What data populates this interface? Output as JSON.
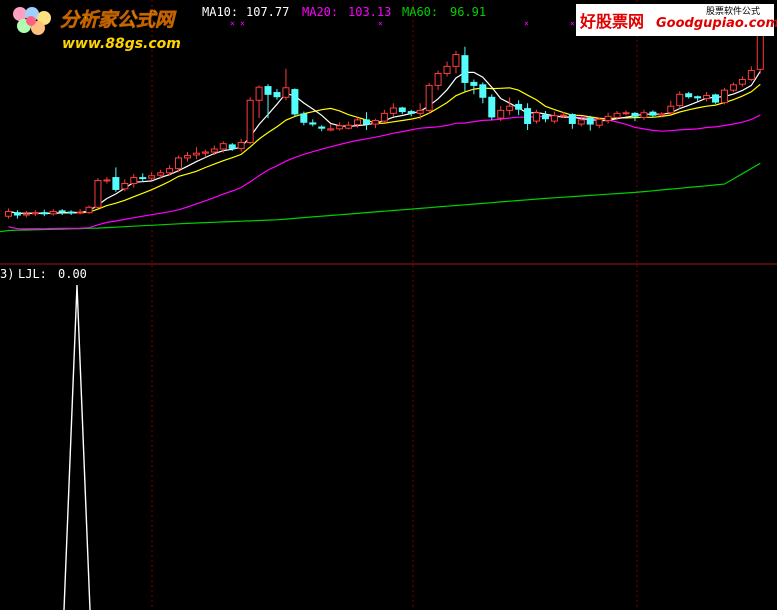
{
  "indicator_header": {
    "ma10_label": "MA10:",
    "ma10_value": "107.77",
    "ma20_label": "MA20:",
    "ma20_value": "103.13",
    "ma60_label": "MA60:",
    "ma60_value": "96.91"
  },
  "sub_header": {
    "prefix": "3)",
    "label": "LJL:",
    "value": "0.00"
  },
  "watermark_left": {
    "title": "分析家公式网",
    "url": "www.88gs.com"
  },
  "watermark_right": {
    "title": "好股票网",
    "domain": "Goodgupiao.com",
    "subtitle": "股票软件公式"
  },
  "colors": {
    "background": "#000000",
    "up": "#ff3c3c",
    "down": "#54fcfc",
    "ma5": "#ffffff",
    "ma10": "#ffff00",
    "ma20": "#ff00ff",
    "ma60": "#00d000",
    "separator": "#a01818",
    "grid": "#800000",
    "indicator": "#ffffff"
  },
  "chart_data": [
    {
      "type": "candlestick",
      "title": "",
      "series": [
        {
          "name": "MA10",
          "last": 107.77
        },
        {
          "name": "MA20",
          "last": 103.13
        },
        {
          "name": "MA60",
          "last": 96.91
        }
      ],
      "candles": [
        [
          88.0,
          88.8,
          87.6,
          89.3
        ],
        [
          88.6,
          88.2,
          87.6,
          89.0
        ],
        [
          88.2,
          88.4,
          87.8,
          88.9
        ],
        [
          88.4,
          88.6,
          88.0,
          89.0
        ],
        [
          88.6,
          88.4,
          88.0,
          89.1
        ],
        [
          88.4,
          88.8,
          88.1,
          89.2
        ],
        [
          88.9,
          88.7,
          88.2,
          89.2
        ],
        [
          88.7,
          88.6,
          88.2,
          89.0
        ],
        [
          88.6,
          88.7,
          88.3,
          89.2
        ],
        [
          88.6,
          89.5,
          88.4,
          89.8
        ],
        [
          89.5,
          94.0,
          89.3,
          94.4
        ],
        [
          94.0,
          94.1,
          93.5,
          94.6
        ],
        [
          94.5,
          92.5,
          92.1,
          96.2
        ],
        [
          92.6,
          93.5,
          92.2,
          94.2
        ],
        [
          93.5,
          94.5,
          92.8,
          95.1
        ],
        [
          94.5,
          94.4,
          93.9,
          95.2
        ],
        [
          94.4,
          94.8,
          94.0,
          95.4
        ],
        [
          94.9,
          95.3,
          94.3,
          95.8
        ],
        [
          95.3,
          96.0,
          94.8,
          96.6
        ],
        [
          96.0,
          97.8,
          95.4,
          98.2
        ],
        [
          97.8,
          98.2,
          97.2,
          98.8
        ],
        [
          98.3,
          98.6,
          97.6,
          99.6
        ],
        [
          98.6,
          98.8,
          97.9,
          99.2
        ],
        [
          98.8,
          99.3,
          98.3,
          99.9
        ],
        [
          99.3,
          100.2,
          98.7,
          100.6
        ],
        [
          100.0,
          99.4,
          99.0,
          100.3
        ],
        [
          99.4,
          100.4,
          98.9,
          101.0
        ],
        [
          100.4,
          107.5,
          100.1,
          108.0
        ],
        [
          107.5,
          109.7,
          104.5,
          110.0
        ],
        [
          109.8,
          108.5,
          104.5,
          110.2
        ],
        [
          108.8,
          108.1,
          107.6,
          109.4
        ],
        [
          108.0,
          109.6,
          107.5,
          112.8
        ],
        [
          109.3,
          105.2,
          104.7,
          109.5
        ],
        [
          105.2,
          103.8,
          103.3,
          105.6
        ],
        [
          103.7,
          103.5,
          103.1,
          104.3
        ],
        [
          103.0,
          102.8,
          102.3,
          103.3
        ],
        [
          102.5,
          102.7,
          102.3,
          103.5
        ],
        [
          102.7,
          103.2,
          102.4,
          103.8
        ],
        [
          102.8,
          103.3,
          102.6,
          103.9
        ],
        [
          103.4,
          104.2,
          102.9,
          104.6
        ],
        [
          104.2,
          103.5,
          102.5,
          105.5
        ],
        [
          103.5,
          104.1,
          102.8,
          104.4
        ],
        [
          104.0,
          105.3,
          103.7,
          105.9
        ],
        [
          105.3,
          106.2,
          104.8,
          107.0
        ],
        [
          106.2,
          105.6,
          105.2,
          106.4
        ],
        [
          105.6,
          105.3,
          104.8,
          105.9
        ],
        [
          105.3,
          105.8,
          104.3,
          107.0
        ],
        [
          105.8,
          110.0,
          105.2,
          110.4
        ],
        [
          110.0,
          112.0,
          109.2,
          112.5
        ],
        [
          112.0,
          113.2,
          111.5,
          114.0
        ],
        [
          113.2,
          115.2,
          112.0,
          115.8
        ],
        [
          115.0,
          110.5,
          109.0,
          116.5
        ],
        [
          110.5,
          110.0,
          108.5,
          111.0
        ],
        [
          110.1,
          108.0,
          107.0,
          110.5
        ],
        [
          108.0,
          104.7,
          104.2,
          108.5
        ],
        [
          104.5,
          105.8,
          104.0,
          106.5
        ],
        [
          105.8,
          106.5,
          105.0,
          108.0
        ],
        [
          106.8,
          106.0,
          105.0,
          107.5
        ],
        [
          106.1,
          103.6,
          102.5,
          107.0
        ],
        [
          104.0,
          105.4,
          103.6,
          105.9
        ],
        [
          105.0,
          104.4,
          103.8,
          105.7
        ],
        [
          104.0,
          104.9,
          103.6,
          105.6
        ],
        [
          104.9,
          105.0,
          104.5,
          105.5
        ],
        [
          105.1,
          103.6,
          102.7,
          105.3
        ],
        [
          103.5,
          104.2,
          103.1,
          104.8
        ],
        [
          104.5,
          103.5,
          102.4,
          104.9
        ],
        [
          103.3,
          104.3,
          102.8,
          104.6
        ],
        [
          104.1,
          104.8,
          103.6,
          105.4
        ],
        [
          104.6,
          105.3,
          104.2,
          105.7
        ],
        [
          105.4,
          105.4,
          105.0,
          105.8
        ],
        [
          105.3,
          104.8,
          104.0,
          105.5
        ],
        [
          104.6,
          105.4,
          104.2,
          105.9
        ],
        [
          105.5,
          105.0,
          104.6,
          105.8
        ],
        [
          105.0,
          105.2,
          104.6,
          105.5
        ],
        [
          105.4,
          106.5,
          105.1,
          107.4
        ],
        [
          106.6,
          108.5,
          106.1,
          109.0
        ],
        [
          108.6,
          108.1,
          107.8,
          108.9
        ],
        [
          108.1,
          107.9,
          107.4,
          108.3
        ],
        [
          107.8,
          108.3,
          107.3,
          108.9
        ],
        [
          108.4,
          107.2,
          106.9,
          108.6
        ],
        [
          107.1,
          109.2,
          106.8,
          109.6
        ],
        [
          109.2,
          110.1,
          108.9,
          110.5
        ],
        [
          110.2,
          111.0,
          109.8,
          111.5
        ],
        [
          111.0,
          112.5,
          110.7,
          113.2
        ],
        [
          112.7,
          119.1,
          112.0,
          120.5
        ]
      ],
      "ma60": [
        [
          0,
          85.6
        ],
        [
          10,
          86.0
        ],
        [
          20,
          86.8
        ],
        [
          30,
          87.4
        ],
        [
          40,
          88.6
        ],
        [
          50,
          89.8
        ],
        [
          60,
          91.0
        ],
        [
          70,
          92.0
        ],
        [
          80,
          93.4
        ],
        [
          84,
          96.9
        ]
      ]
    },
    {
      "type": "line",
      "title": "",
      "series": [
        {
          "name": "LJL",
          "last": 0.0
        }
      ],
      "spike_index": 6,
      "values": [
        0,
        0,
        0,
        0,
        0,
        0,
        1,
        0,
        0,
        0,
        0,
        0,
        0,
        0
      ]
    }
  ]
}
